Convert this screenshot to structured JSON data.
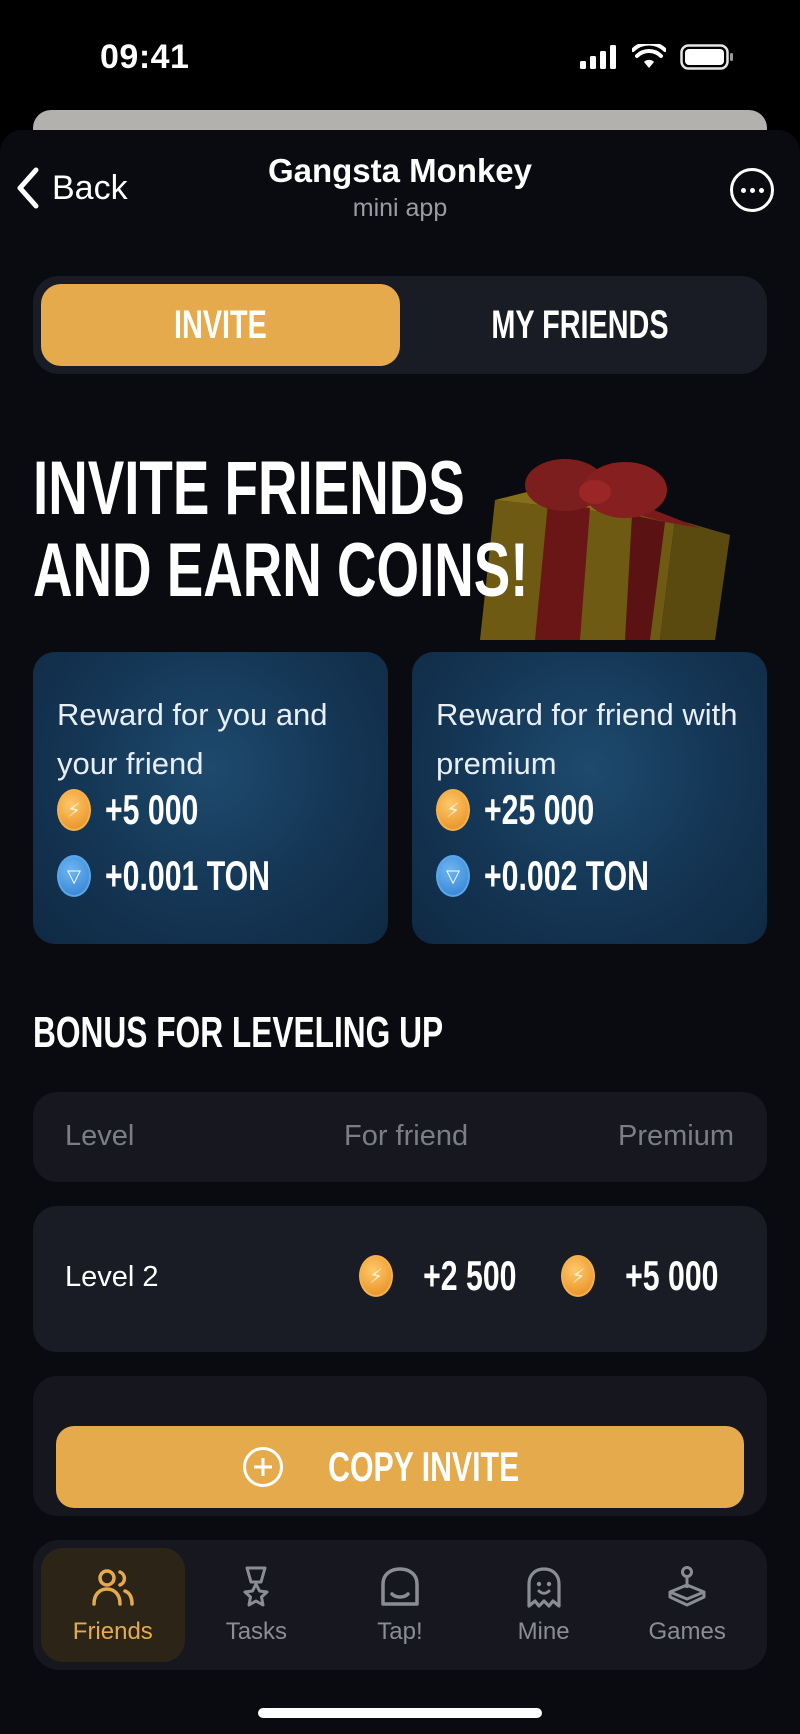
{
  "status_bar": {
    "time": "09:41"
  },
  "header": {
    "back_label": "Back",
    "title": "Gangsta Monkey",
    "subtitle": "mini app"
  },
  "tabs": [
    {
      "label": "INVITE",
      "active": true
    },
    {
      "label": "MY FRIENDS",
      "active": false
    }
  ],
  "hero": {
    "line1": "INVITE FRIENDS",
    "line2": "AND EARN COINS!"
  },
  "rewards": [
    {
      "description": "Reward for you and your friend",
      "coins": "+5 000",
      "ton": "+0.001 TON"
    },
    {
      "description": "Reward for friend with premium",
      "coins": "+25 000",
      "ton": "+0.002 TON"
    }
  ],
  "bonus": {
    "title": "BONUS FOR LEVELING UP",
    "columns": [
      "Level",
      "For friend",
      "Premium"
    ],
    "rows": [
      {
        "level": "Level 2",
        "for_friend": "+2 500",
        "premium": "+5 000"
      }
    ]
  },
  "copy_button": {
    "label": "COPY INVITE"
  },
  "nav": [
    {
      "label": "Friends",
      "icon": "friends-icon",
      "active": true
    },
    {
      "label": "Tasks",
      "icon": "medal-icon",
      "active": false
    },
    {
      "label": "Tap!",
      "icon": "tap-icon",
      "active": false
    },
    {
      "label": "Mine",
      "icon": "ghost-icon",
      "active": false
    },
    {
      "label": "Games",
      "icon": "joystick-icon",
      "active": false
    }
  ],
  "colors": {
    "accent": "#e4aa4c",
    "background": "#0a0b10",
    "card": "#1a1c25",
    "reward_card": "#143554"
  }
}
